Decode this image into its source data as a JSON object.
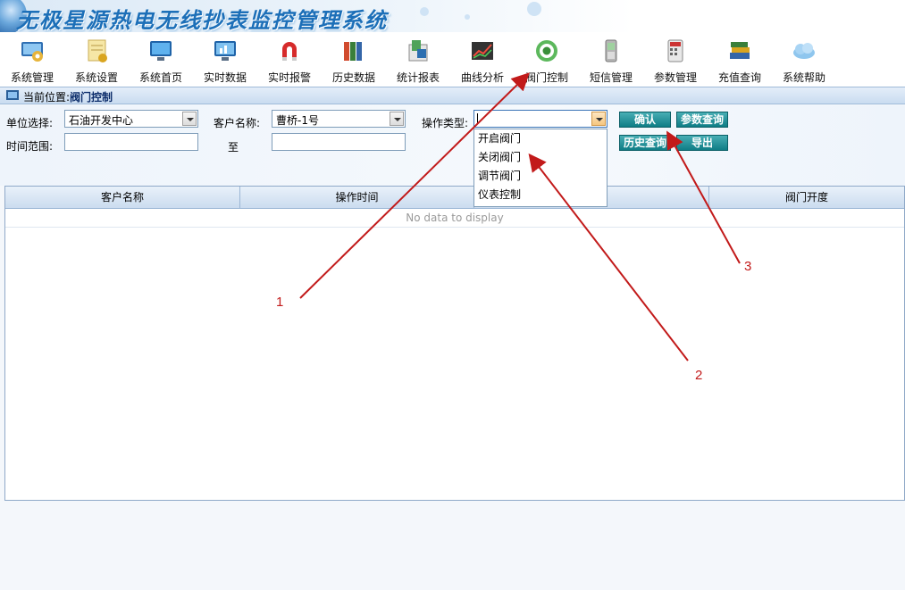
{
  "header": {
    "title": "无极星源热电无线抄表监控管理系统"
  },
  "toolbar": {
    "items": [
      {
        "label": "系统管理",
        "icon": "system-management-icon"
      },
      {
        "label": "系统设置",
        "icon": "system-settings-icon"
      },
      {
        "label": "系统首页",
        "icon": "home-monitor-icon"
      },
      {
        "label": "实时数据",
        "icon": "realtime-data-icon"
      },
      {
        "label": "实时报警",
        "icon": "alarm-magnet-icon"
      },
      {
        "label": "历史数据",
        "icon": "history-books-icon"
      },
      {
        "label": "统计报表",
        "icon": "statistics-report-icon"
      },
      {
        "label": "曲线分析",
        "icon": "curve-chart-icon"
      },
      {
        "label": "阀门控制",
        "icon": "valve-target-icon"
      },
      {
        "label": "短信管理",
        "icon": "sms-phone-icon"
      },
      {
        "label": "参数管理",
        "icon": "parameter-calculator-icon"
      },
      {
        "label": "充值查询",
        "icon": "recharge-books-icon"
      },
      {
        "label": "系统帮助",
        "icon": "help-cloud-icon"
      }
    ]
  },
  "breadcrumb": {
    "prefix": "当前位置:",
    "current": "阀门控制"
  },
  "filters": {
    "unit_label": "单位选择:",
    "unit_value": "石油开发中心",
    "customer_label": "客户名称:",
    "customer_value": "曹桥-1号",
    "optype_label": "操作类型:",
    "optype_value": "",
    "time_label": "时间范围:",
    "time_to": "至",
    "time_from_value": "",
    "time_to_value": ""
  },
  "buttons": {
    "confirm": "确认",
    "param_query": "参数查询",
    "history_query": "历史查询",
    "export": "导出"
  },
  "dropdown": {
    "options": [
      "开启阀门",
      "关闭阀门",
      "调节阀门",
      "仪表控制"
    ]
  },
  "grid": {
    "columns": [
      "客户名称",
      "操作时间",
      "型",
      "阀门开度"
    ],
    "empty_text": "No data to display"
  },
  "annotations": {
    "labels": [
      "1",
      "2",
      "3"
    ],
    "color": "#c21a1a"
  },
  "colors": {
    "button": "#0f7d86",
    "title": "#1c6fb8",
    "annotation": "#c21a1a"
  }
}
